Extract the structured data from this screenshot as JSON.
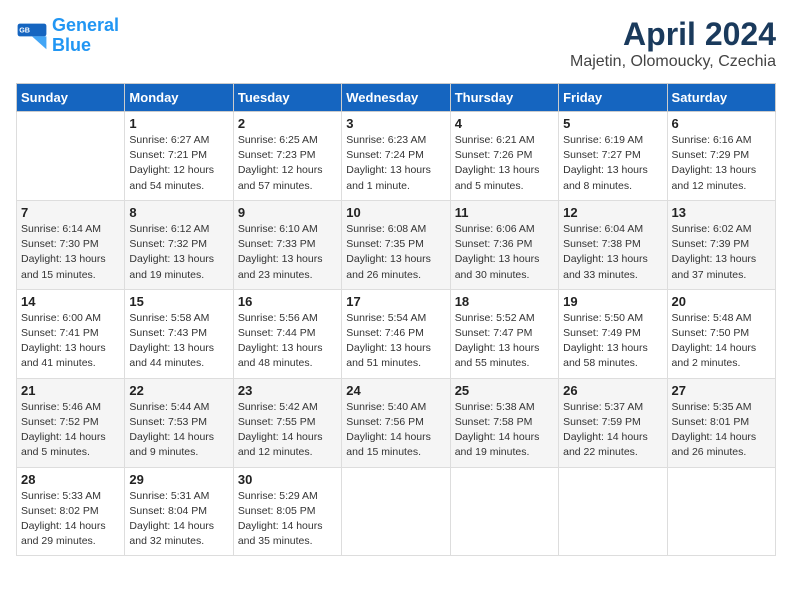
{
  "logo": {
    "line1": "General",
    "line2": "Blue"
  },
  "title": "April 2024",
  "subtitle": "Majetin, Olomoucky, Czechia",
  "days_header": [
    "Sunday",
    "Monday",
    "Tuesday",
    "Wednesday",
    "Thursday",
    "Friday",
    "Saturday"
  ],
  "weeks": [
    [
      {
        "num": "",
        "info": ""
      },
      {
        "num": "1",
        "info": "Sunrise: 6:27 AM\nSunset: 7:21 PM\nDaylight: 12 hours\nand 54 minutes."
      },
      {
        "num": "2",
        "info": "Sunrise: 6:25 AM\nSunset: 7:23 PM\nDaylight: 12 hours\nand 57 minutes."
      },
      {
        "num": "3",
        "info": "Sunrise: 6:23 AM\nSunset: 7:24 PM\nDaylight: 13 hours\nand 1 minute."
      },
      {
        "num": "4",
        "info": "Sunrise: 6:21 AM\nSunset: 7:26 PM\nDaylight: 13 hours\nand 5 minutes."
      },
      {
        "num": "5",
        "info": "Sunrise: 6:19 AM\nSunset: 7:27 PM\nDaylight: 13 hours\nand 8 minutes."
      },
      {
        "num": "6",
        "info": "Sunrise: 6:16 AM\nSunset: 7:29 PM\nDaylight: 13 hours\nand 12 minutes."
      }
    ],
    [
      {
        "num": "7",
        "info": "Sunrise: 6:14 AM\nSunset: 7:30 PM\nDaylight: 13 hours\nand 15 minutes."
      },
      {
        "num": "8",
        "info": "Sunrise: 6:12 AM\nSunset: 7:32 PM\nDaylight: 13 hours\nand 19 minutes."
      },
      {
        "num": "9",
        "info": "Sunrise: 6:10 AM\nSunset: 7:33 PM\nDaylight: 13 hours\nand 23 minutes."
      },
      {
        "num": "10",
        "info": "Sunrise: 6:08 AM\nSunset: 7:35 PM\nDaylight: 13 hours\nand 26 minutes."
      },
      {
        "num": "11",
        "info": "Sunrise: 6:06 AM\nSunset: 7:36 PM\nDaylight: 13 hours\nand 30 minutes."
      },
      {
        "num": "12",
        "info": "Sunrise: 6:04 AM\nSunset: 7:38 PM\nDaylight: 13 hours\nand 33 minutes."
      },
      {
        "num": "13",
        "info": "Sunrise: 6:02 AM\nSunset: 7:39 PM\nDaylight: 13 hours\nand 37 minutes."
      }
    ],
    [
      {
        "num": "14",
        "info": "Sunrise: 6:00 AM\nSunset: 7:41 PM\nDaylight: 13 hours\nand 41 minutes."
      },
      {
        "num": "15",
        "info": "Sunrise: 5:58 AM\nSunset: 7:43 PM\nDaylight: 13 hours\nand 44 minutes."
      },
      {
        "num": "16",
        "info": "Sunrise: 5:56 AM\nSunset: 7:44 PM\nDaylight: 13 hours\nand 48 minutes."
      },
      {
        "num": "17",
        "info": "Sunrise: 5:54 AM\nSunset: 7:46 PM\nDaylight: 13 hours\nand 51 minutes."
      },
      {
        "num": "18",
        "info": "Sunrise: 5:52 AM\nSunset: 7:47 PM\nDaylight: 13 hours\nand 55 minutes."
      },
      {
        "num": "19",
        "info": "Sunrise: 5:50 AM\nSunset: 7:49 PM\nDaylight: 13 hours\nand 58 minutes."
      },
      {
        "num": "20",
        "info": "Sunrise: 5:48 AM\nSunset: 7:50 PM\nDaylight: 14 hours\nand 2 minutes."
      }
    ],
    [
      {
        "num": "21",
        "info": "Sunrise: 5:46 AM\nSunset: 7:52 PM\nDaylight: 14 hours\nand 5 minutes."
      },
      {
        "num": "22",
        "info": "Sunrise: 5:44 AM\nSunset: 7:53 PM\nDaylight: 14 hours\nand 9 minutes."
      },
      {
        "num": "23",
        "info": "Sunrise: 5:42 AM\nSunset: 7:55 PM\nDaylight: 14 hours\nand 12 minutes."
      },
      {
        "num": "24",
        "info": "Sunrise: 5:40 AM\nSunset: 7:56 PM\nDaylight: 14 hours\nand 15 minutes."
      },
      {
        "num": "25",
        "info": "Sunrise: 5:38 AM\nSunset: 7:58 PM\nDaylight: 14 hours\nand 19 minutes."
      },
      {
        "num": "26",
        "info": "Sunrise: 5:37 AM\nSunset: 7:59 PM\nDaylight: 14 hours\nand 22 minutes."
      },
      {
        "num": "27",
        "info": "Sunrise: 5:35 AM\nSunset: 8:01 PM\nDaylight: 14 hours\nand 26 minutes."
      }
    ],
    [
      {
        "num": "28",
        "info": "Sunrise: 5:33 AM\nSunset: 8:02 PM\nDaylight: 14 hours\nand 29 minutes."
      },
      {
        "num": "29",
        "info": "Sunrise: 5:31 AM\nSunset: 8:04 PM\nDaylight: 14 hours\nand 32 minutes."
      },
      {
        "num": "30",
        "info": "Sunrise: 5:29 AM\nSunset: 8:05 PM\nDaylight: 14 hours\nand 35 minutes."
      },
      {
        "num": "",
        "info": ""
      },
      {
        "num": "",
        "info": ""
      },
      {
        "num": "",
        "info": ""
      },
      {
        "num": "",
        "info": ""
      }
    ]
  ]
}
